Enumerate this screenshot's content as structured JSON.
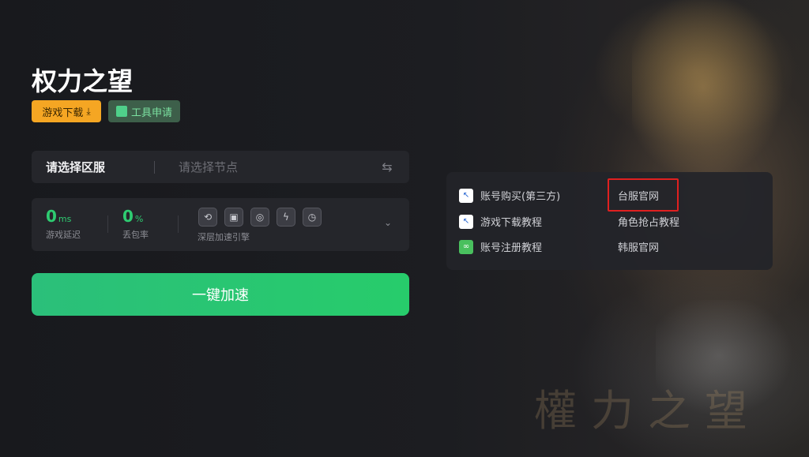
{
  "game": {
    "title": "权力之望",
    "download_label": "游戏下载",
    "tool_label": "工具申请",
    "watermark": "權力之望"
  },
  "server": {
    "region_placeholder": "请选择区服",
    "node_placeholder": "请选择节点"
  },
  "stats": {
    "latency_value": "0",
    "latency_unit": "ms",
    "latency_label": "游戏延迟",
    "loss_value": "0",
    "loss_unit": "%",
    "loss_label": "丢包率",
    "engine_label": "深层加速引擎"
  },
  "accelerate_label": "一键加速",
  "links": {
    "buy_account": "账号购买(第三方)",
    "download_tutorial": "游戏下载教程",
    "register_tutorial": "账号注册教程",
    "tw_official": "台服官网",
    "character_tutorial": "角色抢占教程",
    "kr_official": "韩服官网"
  },
  "colors": {
    "accent_green": "#2ecc71",
    "download_orange": "#f5a623",
    "highlight_red": "#e02020"
  }
}
